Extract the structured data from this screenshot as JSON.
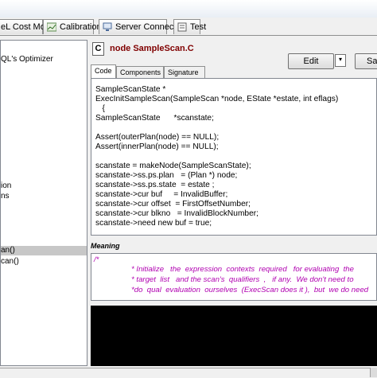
{
  "tabs": [
    {
      "label": "eL Cost Model"
    },
    {
      "label": "Calibration"
    },
    {
      "label": "Server Connection"
    },
    {
      "label": "Test"
    }
  ],
  "tree": {
    "items": [
      {
        "label": "QL's Optimizer"
      },
      {
        "label": "ion"
      },
      {
        "label": "ns"
      },
      {
        "label": "an()"
      },
      {
        "label": "can()"
      }
    ]
  },
  "node": {
    "icon_letter": "C",
    "title": "node SampleScan.C"
  },
  "toolbar": {
    "edit_label": "Edit",
    "save_label": "Sav"
  },
  "subtabs": [
    {
      "label": "Code"
    },
    {
      "label": "Components"
    },
    {
      "label": "Signature"
    }
  ],
  "code_lines": [
    "SampleScanState *",
    "ExecInitSampleScan(SampleScan *node, EState *estate, int eflags)",
    "   {",
    "SampleScanState      *scanstate;",
    "",
    "Assert(outerPlan(node) == NULL);",
    "Assert(innerPlan(node) == NULL);",
    "",
    "scanstate = makeNode(SampleScanState);",
    "scanstate->ss.ps.plan   = (Plan *) node;",
    "scanstate->ss.ps.state  = estate ;",
    "scanstate->cur buf     = InvalidBuffer;",
    "scanstate->cur offset  = FirstOffsetNumber;",
    "scanstate->cur blkno   = InvalidBlockNumber;",
    "scanstate->need new buf = true;"
  ],
  "meaning": {
    "label": "Meaning",
    "lines": [
      "/*",
      "* Initialize   the  expression  contexts  required   for evaluating  the",
      "* target  list   and the scan's  qualifiers  ,   if any.  We don't need to",
      "*do  qual  evaluation  ourselves  (ExecScan does it ),  but  we do need"
    ]
  },
  "colors": {
    "title_red": "#800000",
    "comment_magenta": "#b000b0",
    "selection_gray": "#c7c7c7"
  }
}
